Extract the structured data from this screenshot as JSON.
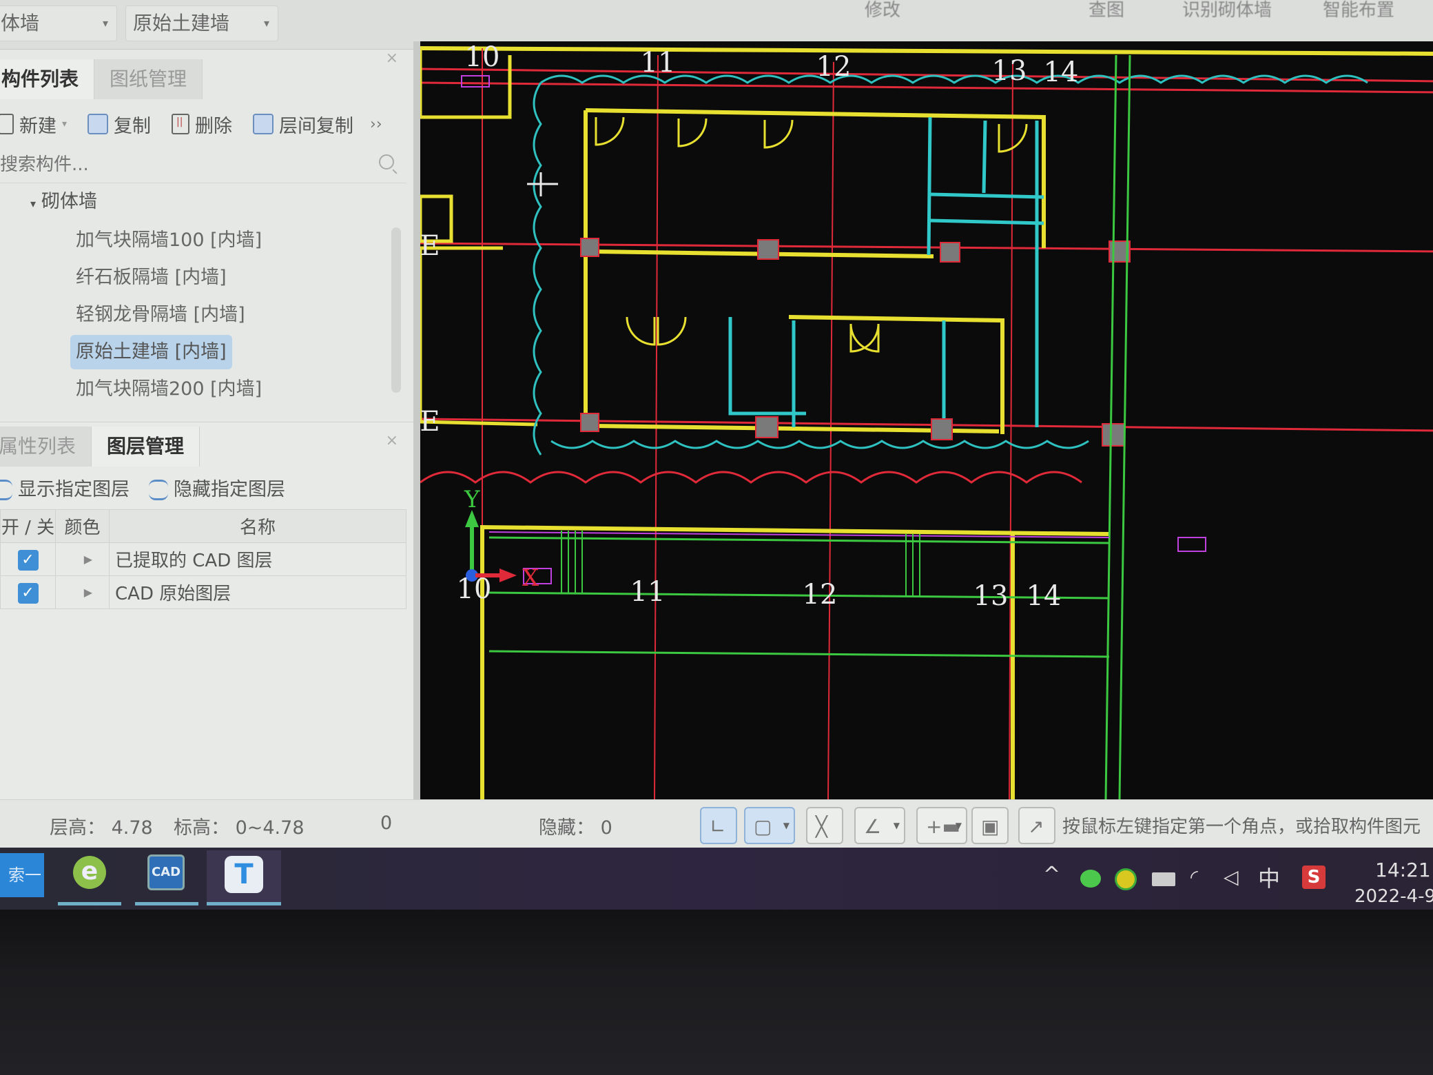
{
  "top_bar": {
    "combo_1_value": "体墙",
    "combo_2_value": "原始土建墙",
    "tabs": [
      "修改",
      "查图",
      "识别砌体墙",
      "智能布置"
    ]
  },
  "component_panel": {
    "tabs": [
      {
        "label": "构件列表",
        "active": true
      },
      {
        "label": "图纸管理",
        "active": false
      }
    ],
    "toolbar": {
      "new_label": "新建",
      "copy_label": "复制",
      "delete_label": "删除",
      "floor_copy_label": "层间复制",
      "more_label": "››"
    },
    "search_placeholder": "搜索构件...",
    "tree": {
      "group_label": "砌体墙",
      "items": [
        {
          "label": "加气块隔墙100 [内墙]",
          "selected": false
        },
        {
          "label": "纤石板隔墙 [内墙]",
          "selected": false
        },
        {
          "label": "轻钢龙骨隔墙 [内墙]",
          "selected": false
        },
        {
          "label": "原始土建墙 [内墙]",
          "selected": true
        },
        {
          "label": "加气块隔墙200 [内墙]",
          "selected": false
        }
      ]
    },
    "close_label": "×"
  },
  "layer_panel": {
    "tabs": [
      {
        "label": "属性列表",
        "active": false
      },
      {
        "label": "图层管理",
        "active": true
      }
    ],
    "close_label": "×",
    "toolbar": {
      "show_label": "显示指定图层",
      "hide_label": "隐藏指定图层"
    },
    "columns": [
      "开 / 关",
      "颜色",
      "名称"
    ],
    "rows": [
      {
        "on": true,
        "name": "已提取的 CAD 图层"
      },
      {
        "on": true,
        "name": "CAD 原始图层"
      }
    ]
  },
  "cad_canvas": {
    "axis_labels_top": [
      "10",
      "11",
      "12",
      "13",
      "14"
    ],
    "axis_labels_bottom": [
      "10",
      "11",
      "12",
      "13",
      "14"
    ],
    "row_labels": [
      "E",
      "E"
    ],
    "ucs_x_label": "X",
    "ucs_y_label": "Y",
    "colors": {
      "background": "#0b0b0b",
      "wall": "#e8e030",
      "axis": "#e02a3a",
      "cloud": "#2fc0c0",
      "cloud_red": "#e02a3a",
      "green": "#3cc840",
      "magenta": "#c040e0",
      "column": "#7a7a7a",
      "cyan_fixture": "#30c8c8"
    }
  },
  "status_bar": {
    "floor_height": "层高： 4.78",
    "elevation": "标高： 0~4.78",
    "count": "0",
    "hidden": "隐藏： 0",
    "prompt": "按鼠标左键指定第一个角点，或拾取构件图元"
  },
  "taskbar": {
    "search_label": "索一下",
    "apps": [
      "browser-e",
      "cad-app",
      "t-app"
    ],
    "cad_label": "CAD",
    "t_label": "T",
    "tray": {
      "chevron": "^",
      "ime": "中",
      "sogou": "S"
    },
    "time": "14:21",
    "date": "2022-4-9"
  }
}
